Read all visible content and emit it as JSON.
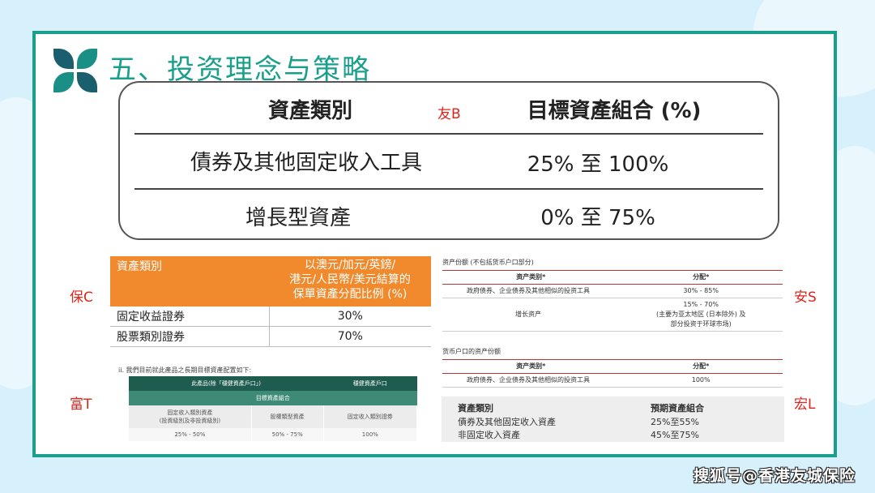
{
  "title": "五、投资理念与策略",
  "main_table": {
    "headers": [
      "資產類別",
      "目標資產組合 (%)"
    ],
    "rows": [
      [
        "債券及其他固定收入工具",
        "25% 至 100%"
      ],
      [
        "增長型資產",
        "0% 至 75%"
      ]
    ]
  },
  "tags": {
    "b": "友B",
    "c": "保C",
    "s": "安S",
    "t": "富T",
    "l": "宏L"
  },
  "orange_table": {
    "header_col1": "資產類別",
    "header_col2_lines": [
      "以澳元/加元/英鎊/",
      "港元/人民幣/美元結算的",
      "保單資產分配比例 (%)"
    ],
    "rows": [
      [
        "固定收益證券",
        "30%"
      ],
      [
        "股票類別證券",
        "70%"
      ]
    ]
  },
  "green_table": {
    "note": "ii.   我們目前就此產品之長期目標資產配置如下:",
    "head_a": "此產品(除「穩健資產戶口」)",
    "head_b": "穩健資產戶口",
    "subhead": "目標資產組合",
    "labels": [
      "固定收入類別資產\n(投資級別及非投資級別)",
      "股權類型資產",
      "固定收入類別證券"
    ],
    "values": [
      "25% - 50%",
      "50% - 75%",
      "100%"
    ]
  },
  "sc_table": {
    "caption1": "资产份额 (不包括货币户口部分)",
    "header": [
      "资产类别*",
      "分配*"
    ],
    "rows1": [
      [
        "政府债券、企业债券及其他相似的投资工具",
        "30% - 85%"
      ],
      [
        "增长资产",
        "15% - 70%\n(主要为亚太地区 (日本除外) 及\n部分投资于环球市场)"
      ]
    ],
    "caption2": "货币户口的资产份额",
    "rows2": [
      [
        "政府债券、企业债券及其他相似的投资工具",
        "100%"
      ]
    ]
  },
  "grey_table": {
    "headers": [
      "資產類別",
      "預期資產組合"
    ],
    "rows": [
      [
        "債券及其他固定收入資產",
        "25%至55%"
      ],
      [
        "非固定收入資產",
        "45%至75%"
      ]
    ]
  },
  "watermark": "搜狐号@香港友城保险"
}
